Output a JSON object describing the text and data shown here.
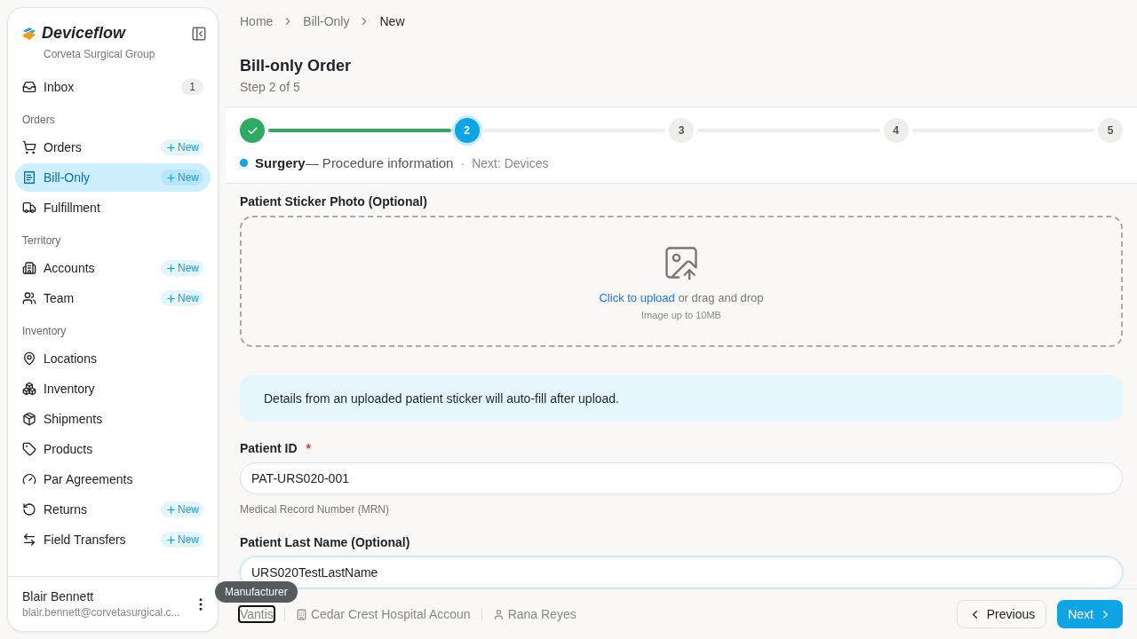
{
  "sidebar": {
    "brand": "Deviceflow",
    "org": "Corveta Surgical Group",
    "sections": [
      {
        "items": [
          {
            "label": "Inbox",
            "count": "1",
            "selected": false
          }
        ]
      },
      {
        "heading": "Orders",
        "items": [
          {
            "label": "Orders",
            "new": "New",
            "selected": false
          },
          {
            "label": "Bill-Only",
            "new": "New",
            "selected": true
          },
          {
            "label": "Fulfillment",
            "selected": false
          }
        ]
      },
      {
        "heading": "Territory",
        "items": [
          {
            "label": "Accounts",
            "new": "New",
            "selected": false
          },
          {
            "label": "Team",
            "new": "New",
            "selected": false
          }
        ]
      },
      {
        "heading": "Inventory",
        "items": [
          {
            "label": "Locations",
            "selected": false
          },
          {
            "label": "Inventory",
            "selected": false
          },
          {
            "label": "Shipments",
            "selected": false
          },
          {
            "label": "Products",
            "selected": false
          },
          {
            "label": "Par Agreements",
            "selected": false
          },
          {
            "label": "Returns",
            "new": "New",
            "selected": false
          },
          {
            "label": "Field Transfers",
            "new": "New",
            "selected": false
          }
        ]
      }
    ],
    "user": {
      "name": "Blair Bennett",
      "email": "blair.bennett@corvetasurgical.c..."
    }
  },
  "breadcrumbs": [
    "Home",
    "Bill-Only",
    "New"
  ],
  "title": "Bill-only Order",
  "subtitle": "Step 2 of 5",
  "steps": [
    {
      "kind": "done"
    },
    {
      "kind": "current",
      "label": "2"
    },
    {
      "kind": "upcoming",
      "label": "3"
    },
    {
      "kind": "upcoming",
      "label": "4"
    },
    {
      "kind": "upcoming",
      "label": "5"
    }
  ],
  "step_caption": {
    "name": "Surgery",
    "description": "— Procedure information",
    "separator": "·",
    "next": "Next: Devices"
  },
  "upload": {
    "label": "Patient Sticker Photo (Optional)",
    "link": "Click to upload",
    "rest": "or drag and drop",
    "hint": "Image up to 10MB"
  },
  "notice": "Details from an uploaded patient sticker will auto-fill after upload.",
  "fields": [
    {
      "label": "Patient ID",
      "required_mark": "*",
      "value": "PAT-URS020-001",
      "help": "Medical Record Number (MRN)",
      "focused": false
    },
    {
      "label": "Patient Last Name (Optional)",
      "value": "URS020TestLastName",
      "focused": true
    }
  ],
  "footer": {
    "chips": [
      {
        "kind": "plain",
        "text": "Vantis",
        "tooltip": "Manufacturer"
      },
      {
        "kind": "account",
        "text": "Cedar Crest Hospital Accoun"
      },
      {
        "kind": "person",
        "text": "Rana Reyes"
      }
    ],
    "previous": "Previous",
    "next": "Next"
  }
}
